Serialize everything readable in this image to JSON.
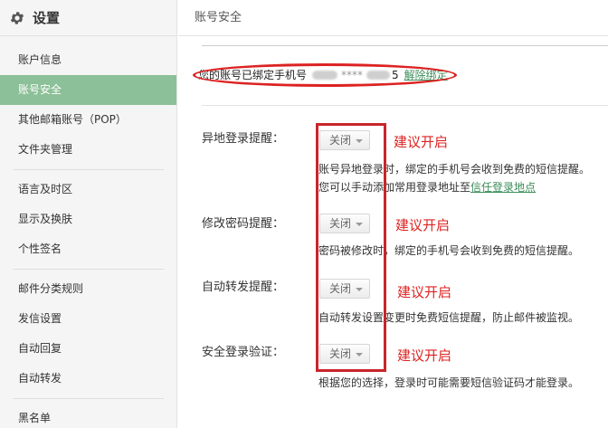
{
  "sidebar": {
    "title": "设置",
    "groups": [
      [
        "账户信息",
        "账号安全",
        "其他邮箱账号（POP）",
        "文件夹管理"
      ],
      [
        "语言及时区",
        "显示及换肤",
        "个性签名"
      ],
      [
        "邮件分类规则",
        "发信设置",
        "自动回复",
        "自动转发"
      ],
      [
        "黑名单"
      ]
    ],
    "active": "账号安全"
  },
  "main": {
    "title": "账号安全",
    "phone": {
      "prefix": "您的账号已绑定手机号",
      "masked": "****",
      "suffix_digit": "5",
      "unbind_link": "解除绑定"
    },
    "settings": [
      {
        "label": "异地登录提醒：",
        "value": "关闭",
        "advice": "建议开启",
        "desc1": "账号异地登录时，绑定的手机号会收到免费的短信提醒。",
        "desc2_prefix": "您可以手动添加常用登录地址至",
        "desc2_link": "信任登录地点"
      },
      {
        "label": "修改密码提醒：",
        "value": "关闭",
        "advice": "建议开启",
        "desc1": "密码被修改时，绑定的手机号会收到免费的短信提醒。"
      },
      {
        "label": "自动转发提醒：",
        "value": "关闭",
        "advice": "建议开启",
        "desc1": "自动转发设置变更时免费短信提醒，防止邮件被监视。"
      },
      {
        "label": "安全登录验证：",
        "value": "关闭",
        "advice": "建议开启",
        "desc1": "根据您的选择，登录时可能需要短信验证码才能登录。"
      }
    ]
  },
  "colors": {
    "active_nav": "#8cc098",
    "annotation_red": "#d22222",
    "link_green": "#3c8d5a"
  }
}
